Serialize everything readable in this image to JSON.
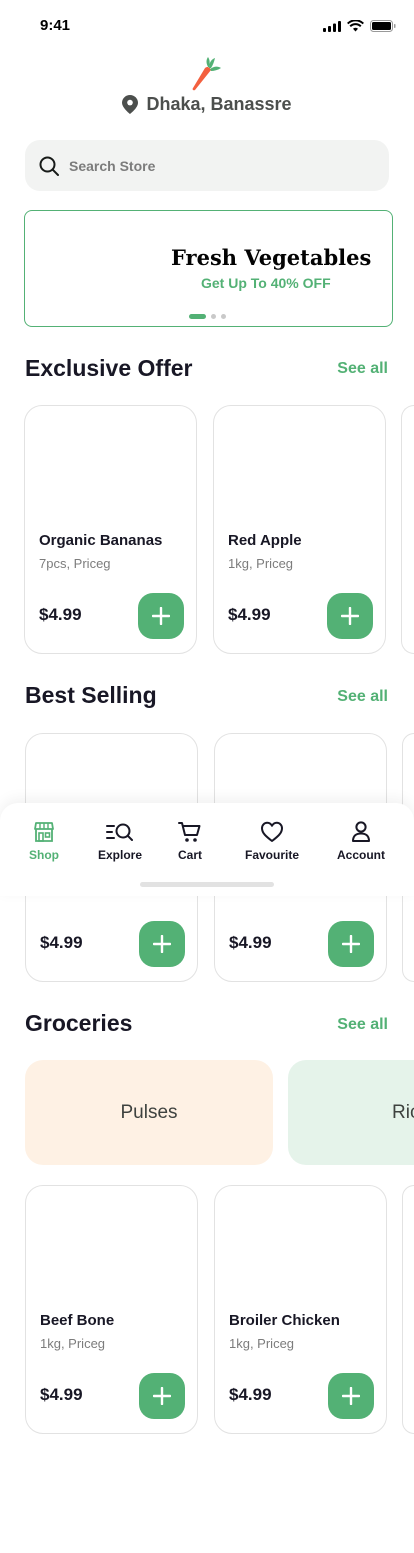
{
  "status_bar": {
    "time": "9:41"
  },
  "header": {
    "location": "Dhaka, Banassre"
  },
  "search": {
    "placeholder": "Search Store"
  },
  "banner": {
    "title": "Fresh Vegetables",
    "subtitle": "Get Up To 40% OFF"
  },
  "sections": {
    "exclusive": {
      "title": "Exclusive Offer",
      "see_all": "See all",
      "items": [
        {
          "name": "Organic Bananas",
          "meta": "7pcs, Priceg",
          "price": "$4.99"
        },
        {
          "name": "Red Apple",
          "meta": "1kg, Priceg",
          "price": "$4.99"
        }
      ]
    },
    "best": {
      "title": "Best Selling",
      "see_all": "See all",
      "items": [
        {
          "price": "$4.99"
        },
        {
          "price": "$4.99"
        }
      ]
    },
    "groceries": {
      "title": "Groceries",
      "see_all": "See all",
      "categories": [
        {
          "label": "Pulses",
          "color": "#fef1e4"
        },
        {
          "label": "Ric",
          "color": "#e5f3ea"
        }
      ],
      "items": [
        {
          "name": "Beef Bone",
          "meta": "1kg, Priceg",
          "price": "$4.99"
        },
        {
          "name": "Broiler Chicken",
          "meta": "1kg, Priceg",
          "price": "$4.99"
        }
      ]
    }
  },
  "tabs": [
    {
      "label": "Shop",
      "icon": "shop-icon",
      "active": true
    },
    {
      "label": "Explore",
      "icon": "explore-icon",
      "active": false
    },
    {
      "label": "Cart",
      "icon": "cart-icon",
      "active": false
    },
    {
      "label": "Favourite",
      "icon": "heart-icon",
      "active": false
    },
    {
      "label": "Account",
      "icon": "account-icon",
      "active": false
    }
  ],
  "colors": {
    "primary": "#53b175",
    "text": "#181725",
    "muted": "#7c7c7c",
    "carrot": "#f3603f"
  }
}
